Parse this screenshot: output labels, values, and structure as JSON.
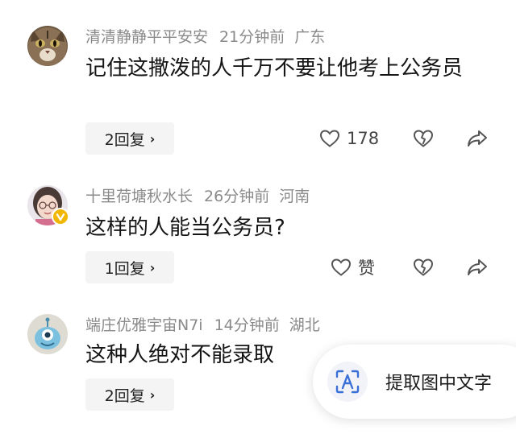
{
  "comments": [
    {
      "user": "清清静静平平安安",
      "time": "21分钟前",
      "location": "广东",
      "text": "记住这撒泼的人千万不要让他考上公务员",
      "reply_label": "2回复",
      "like_label": "178",
      "avatar_icon": "cat-face-avatar"
    },
    {
      "user": "十里荷塘秋水长",
      "time": "26分钟前",
      "location": "河南",
      "text": "这样的人能当公务员?",
      "reply_label": "1回复",
      "like_label": "赞",
      "avatar_icon": "woman-with-glasses-avatar"
    },
    {
      "user": "端庄优雅宇宙N7i",
      "time": "14分钟前",
      "location": "湖北",
      "text": "这种人绝对不能录取",
      "reply_label": "2回复",
      "avatar_icon": "alien-cartoon-avatar"
    }
  ],
  "ocr_button": {
    "label": "提取图中文字",
    "icon": "text-scan-icon"
  },
  "colors": {
    "meta_text": "#8a8a8a",
    "body_text": "#151515",
    "icon_gray": "#555555",
    "verified_badge": "#f2b705"
  }
}
